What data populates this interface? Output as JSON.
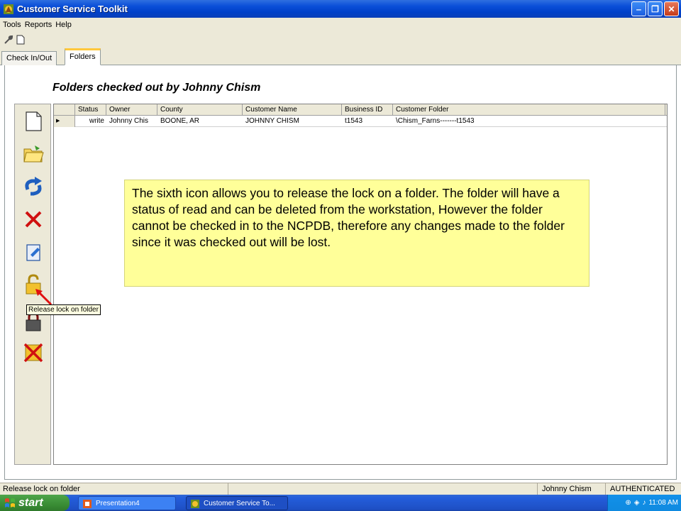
{
  "window": {
    "title": "Customer Service Toolkit"
  },
  "menu": [
    "Tools",
    "Reports",
    "Help"
  ],
  "tabs": [
    {
      "label": "Check In/Out",
      "active": false
    },
    {
      "label": "Folders",
      "active": true
    }
  ],
  "heading": "Folders checked out by Johnny Chism",
  "grid": {
    "columns": [
      "Status",
      "Owner",
      "County",
      "Customer Name",
      "Business ID",
      "Customer Folder"
    ],
    "rows": [
      {
        "status": "write",
        "owner": "Johnny Chis",
        "county": "BOONE, AR",
        "customer_name": "JOHNNY CHISM",
        "business_id": "t1543",
        "customer_folder": "\\Chism_Farns-------t1543"
      }
    ]
  },
  "iconbar": {
    "icons": [
      "new-document-icon",
      "open-folder-icon",
      "refresh-icon",
      "delete-icon",
      "edit-icon",
      "unlock-icon",
      "lock-icon",
      "delete-all-icon"
    ]
  },
  "callout_text": "The sixth icon allows you to release the lock on a folder. The folder will have a status of read and can be deleted from the workstation, However the folder cannot be checked in to the NCPDB, therefore any changes made to the folder since it was checked out will be lost.",
  "tooltip": "Release lock on folder",
  "statusbar": {
    "message": "Release lock on folder",
    "user": "Johnny Chism",
    "auth": "AUTHENTICATED"
  },
  "taskbar": {
    "start": "start",
    "items": [
      "Presentation4",
      "Customer Service To..."
    ],
    "clock": "11:08 AM"
  },
  "colors": {
    "callout_bg": "#ffff99",
    "titlebar": "#0a4ed8",
    "active_tab_accent": "#ffc83c"
  }
}
